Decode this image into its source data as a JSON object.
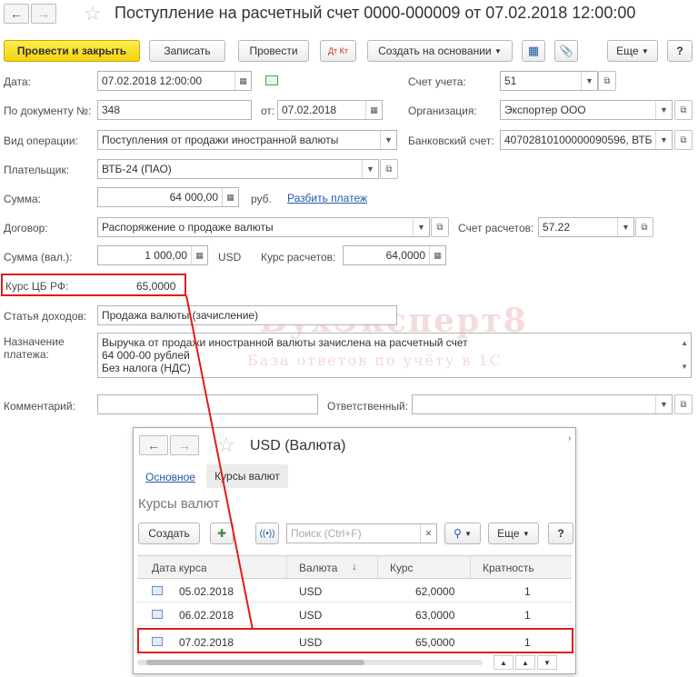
{
  "window": {
    "title": "Поступление на расчетный счет 0000-000009 от 07.02.2018 12:00:00"
  },
  "toolbar": {
    "post_close": "Провести и закрыть",
    "save": "Записать",
    "post": "Провести",
    "dt_kt": "Дт Кт",
    "create_based": "Создать на основании",
    "more": "Еще",
    "help": "?"
  },
  "form": {
    "date_label": "Дата:",
    "date_value": "07.02.2018 12:00:00",
    "account_label": "Счет учета:",
    "account_value": "51",
    "doc_label": "По документу №:",
    "doc_value": "348",
    "from_label": "от:",
    "from_value": "07.02.2018",
    "org_label": "Организация:",
    "org_value": "Экспортер ООО",
    "optype_label": "Вид операции:",
    "optype_value": "Поступления от продажи иностранной валюты",
    "bank_label": "Банковский счет:",
    "bank_value": "40702810100000090596, ВТБ",
    "payer_label": "Плательщик:",
    "payer_value": "ВТБ-24 (ПАО)",
    "sum_label": "Сумма:",
    "sum_value": "64 000,00",
    "sum_unit": "руб.",
    "split_link": "Разбить платеж",
    "contract_label": "Договор:",
    "contract_value": "Распоряжение о продаже валюты",
    "settle_label": "Счет расчетов:",
    "settle_value": "57.22",
    "sumcur_label": "Сумма (вал.):",
    "sumcur_value": "1 000,00",
    "sumcur_unit": "USD",
    "rate_label": "Курс расчетов:",
    "rate_value": "64,0000",
    "cbrate_label": "Курс ЦБ РФ:",
    "cbrate_value": "65,0000",
    "income_label": "Статья доходов:",
    "income_value": "Продажа валюты (зачисление)",
    "purpose_label_1": "Назначение",
    "purpose_label_2": "платежа:",
    "purpose_line1": "Выручка от продажи иностранной валюты зачислена на расчетный счет",
    "purpose_line2": "64 000-00    рублей",
    "purpose_line3": "Без налога (НДС)",
    "comment_label": "Комментарий:",
    "responsible_label": "Ответственный:"
  },
  "watermark": {
    "line1": "БухЭксперт8",
    "line2": "База ответов по учёту в 1С"
  },
  "popup": {
    "title": "USD (Валюта)",
    "tab_main": "Основное",
    "tab_rates": "Курсы валют",
    "section_title": "Курсы валют",
    "create": "Создать",
    "search_placeholder": "Поиск (Ctrl+F)",
    "more": "Еще",
    "help": "?",
    "columns": [
      "Дата курса",
      "Валюта",
      "Курс",
      "Кратность"
    ],
    "rows": [
      {
        "date": "05.02.2018",
        "currency": "USD",
        "rate": "62,0000",
        "mult": "1"
      },
      {
        "date": "06.02.2018",
        "currency": "USD",
        "rate": "63,0000",
        "mult": "1"
      },
      {
        "date": "07.02.2018",
        "currency": "USD",
        "rate": "65,0000",
        "mult": "1"
      }
    ]
  },
  "colors": {
    "accent_yellow": "#f5d20e",
    "highlight_red": "#e01b1b",
    "link_blue": "#2159a9"
  }
}
